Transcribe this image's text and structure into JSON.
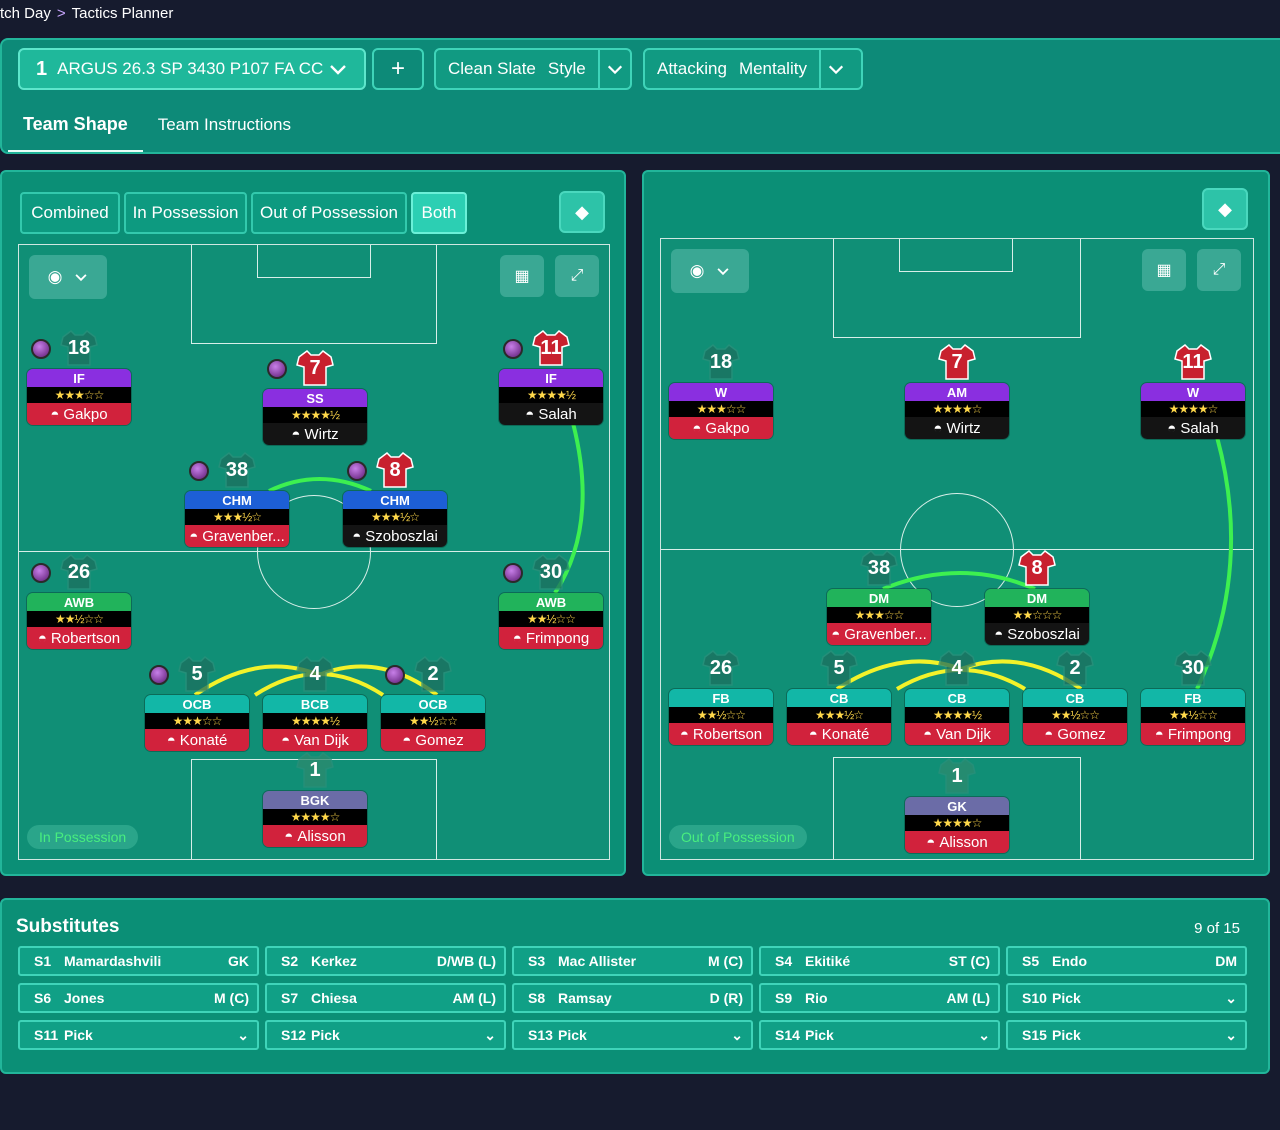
{
  "breadcrumb": {
    "a": "tch Day",
    "sep": ">",
    "b": "Tactics Planner"
  },
  "tactic": {
    "number": "1",
    "name": "ARGUS 26.3 SP 3430 P107 FA CC",
    "add": "+"
  },
  "style": {
    "value": "Clean Slate",
    "label": "Style"
  },
  "mentality": {
    "value": "Attacking",
    "label": "Mentality"
  },
  "tabs": [
    "Team Shape",
    "Team Instructions"
  ],
  "view_buttons": [
    "Combined",
    "In Possession",
    "Out of Possession",
    "Both"
  ],
  "left_mode": "In Possession",
  "right_mode": "Out of Possession",
  "left_players": [
    {
      "num": "18",
      "role": "IF",
      "stars": "★★★☆☆",
      "name": "Gakpo",
      "pos": "purple",
      "nm": "red",
      "dot": true,
      "kit": "faded"
    },
    {
      "num": "7",
      "role": "SS",
      "stars": "★★★★½",
      "name": "Wirtz",
      "pos": "purple",
      "nm": "black",
      "dot": true,
      "kit": "red"
    },
    {
      "num": "11",
      "role": "IF",
      "stars": "★★★★½",
      "name": "Salah",
      "pos": "purple",
      "nm": "black",
      "dot": true,
      "kit": "red"
    },
    {
      "num": "38",
      "role": "CHM",
      "stars": "★★★½☆",
      "name": "Gravenber...",
      "pos": "blue",
      "nm": "red",
      "dot": true,
      "kit": "faded"
    },
    {
      "num": "8",
      "role": "CHM",
      "stars": "★★★½☆",
      "name": "Szoboszlai",
      "pos": "blue",
      "nm": "black",
      "dot": true,
      "kit": "red"
    },
    {
      "num": "26",
      "role": "AWB",
      "stars": "★★½☆☆",
      "name": "Robertson",
      "pos": "green",
      "nm": "red",
      "dot": true,
      "kit": "faded"
    },
    {
      "num": "30",
      "role": "AWB",
      "stars": "★★½☆☆",
      "name": "Frimpong",
      "pos": "green",
      "nm": "red",
      "dot": true,
      "kit": "faded"
    },
    {
      "num": "5",
      "role": "OCB",
      "stars": "★★★☆☆",
      "name": "Konaté",
      "pos": "teal",
      "nm": "red",
      "dot": true,
      "kit": "faded"
    },
    {
      "num": "4",
      "role": "BCB",
      "stars": "★★★★½",
      "name": "Van Dijk",
      "pos": "teal",
      "nm": "red",
      "dot": false,
      "kit": "faded"
    },
    {
      "num": "2",
      "role": "OCB",
      "stars": "★★½☆☆",
      "name": "Gomez",
      "pos": "teal",
      "nm": "red",
      "dot": true,
      "kit": "faded"
    },
    {
      "num": "1",
      "role": "BGK",
      "stars": "★★★★☆",
      "name": "Alisson",
      "pos": "gk",
      "nm": "red",
      "dot": false,
      "kit": "gk"
    }
  ],
  "right_players": [
    {
      "num": "18",
      "role": "W",
      "stars": "★★★☆☆",
      "name": "Gakpo",
      "pos": "purple",
      "nm": "red",
      "kit": "faded"
    },
    {
      "num": "7",
      "role": "AM",
      "stars": "★★★★☆",
      "name": "Wirtz",
      "pos": "purple",
      "nm": "black",
      "kit": "red"
    },
    {
      "num": "11",
      "role": "W",
      "stars": "★★★★☆",
      "name": "Salah",
      "pos": "purple",
      "nm": "black",
      "kit": "red"
    },
    {
      "num": "38",
      "role": "DM",
      "stars": "★★★☆☆",
      "name": "Gravenber...",
      "pos": "green",
      "nm": "red",
      "kit": "faded"
    },
    {
      "num": "8",
      "role": "DM",
      "stars": "★★☆☆☆",
      "name": "Szoboszlai",
      "pos": "green",
      "nm": "black",
      "kit": "red"
    },
    {
      "num": "26",
      "role": "FB",
      "stars": "★★½☆☆",
      "name": "Robertson",
      "pos": "teal",
      "nm": "red",
      "kit": "faded"
    },
    {
      "num": "5",
      "role": "CB",
      "stars": "★★★½☆",
      "name": "Konaté",
      "pos": "teal",
      "nm": "red",
      "kit": "faded"
    },
    {
      "num": "4",
      "role": "CB",
      "stars": "★★★★½",
      "name": "Van Dijk",
      "pos": "teal",
      "nm": "red",
      "kit": "faded"
    },
    {
      "num": "2",
      "role": "CB",
      "stars": "★★½☆☆",
      "name": "Gomez",
      "pos": "teal",
      "nm": "red",
      "kit": "faded"
    },
    {
      "num": "30",
      "role": "FB",
      "stars": "★★½☆☆",
      "name": "Frimpong",
      "pos": "teal",
      "nm": "red",
      "kit": "faded"
    },
    {
      "num": "1",
      "role": "GK",
      "stars": "★★★★☆",
      "name": "Alisson",
      "pos": "gk",
      "nm": "red",
      "kit": "gk"
    }
  ],
  "substitutes": {
    "title": "Substitutes",
    "count": "9 of 15",
    "items": [
      {
        "slot": "S1",
        "name": "Mamardashvili",
        "pos": "GK"
      },
      {
        "slot": "S2",
        "name": "Kerkez",
        "pos": "D/WB (L)"
      },
      {
        "slot": "S3",
        "name": "Mac Allister",
        "pos": "M (C)"
      },
      {
        "slot": "S4",
        "name": "Ekitiké",
        "pos": "ST (C)"
      },
      {
        "slot": "S5",
        "name": "Endo",
        "pos": "DM"
      },
      {
        "slot": "S6",
        "name": "Jones",
        "pos": "M (C)"
      },
      {
        "slot": "S7",
        "name": "Chiesa",
        "pos": "AM (L)"
      },
      {
        "slot": "S8",
        "name": "Ramsay",
        "pos": "D (R)"
      },
      {
        "slot": "S9",
        "name": "Rio",
        "pos": "AM (L)"
      },
      {
        "slot": "S10",
        "name": "Pick",
        "pos": "⌄"
      },
      {
        "slot": "S11",
        "name": "Pick",
        "pos": "⌄"
      },
      {
        "slot": "S12",
        "name": "Pick",
        "pos": "⌄"
      },
      {
        "slot": "S13",
        "name": "Pick",
        "pos": "⌄"
      },
      {
        "slot": "S14",
        "name": "Pick",
        "pos": "⌄"
      },
      {
        "slot": "S15",
        "name": "Pick",
        "pos": "⌄"
      }
    ]
  },
  "colors": {
    "accent": "#0d8a78",
    "link_green": "#3df050",
    "link_yellow": "#f3f22a"
  }
}
